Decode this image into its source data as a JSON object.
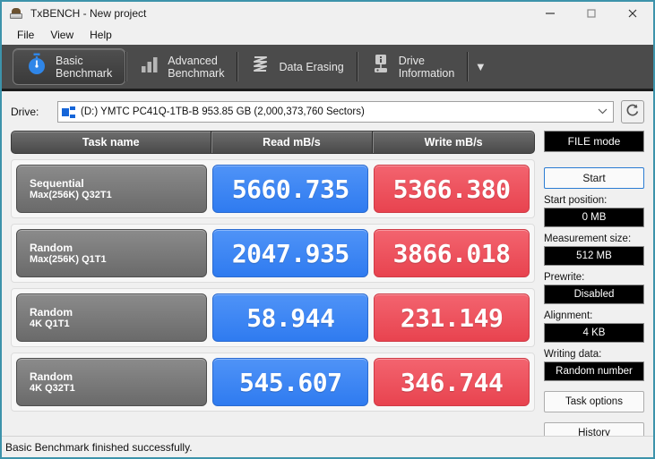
{
  "window": {
    "title": "TxBENCH - New project",
    "icon": "app-icon",
    "controls": {
      "minimize": "—",
      "maximize": "□",
      "close": "✕"
    }
  },
  "menubar": {
    "items": [
      {
        "label": "File"
      },
      {
        "label": "View"
      },
      {
        "label": "Help"
      }
    ]
  },
  "tabs": [
    {
      "label": "Basic\nBenchmark",
      "icon": "stopwatch-icon",
      "active": true
    },
    {
      "label": "Advanced\nBenchmark",
      "icon": "bar-chart-icon",
      "active": false
    },
    {
      "label": "Data Erasing",
      "icon": "shredder-icon",
      "active": false
    },
    {
      "label": "Drive\nInformation",
      "icon": "drive-info-icon",
      "active": false
    }
  ],
  "tab_overflow": {
    "icon": "chevron-down-icon",
    "label": "▼"
  },
  "drive": {
    "label": "Drive:",
    "selected": "(D:) YMTC PC41Q-1TB-B  953.85 GB (2,000,373,760 Sectors)",
    "dropdown_icon": "chevron-down-icon",
    "refresh_icon": "refresh-icon"
  },
  "table": {
    "headers": {
      "task": "Task name",
      "read": "Read mB/s",
      "write": "Write mB/s"
    },
    "rows": [
      {
        "name_line1": "Sequential",
        "name_line2": "Max(256K) Q32T1",
        "read": "5660.735",
        "write": "5366.380"
      },
      {
        "name_line1": "Random",
        "name_line2": "Max(256K) Q1T1",
        "read": "2047.935",
        "write": "3866.018"
      },
      {
        "name_line1": "Random",
        "name_line2": "4K Q1T1",
        "read": "58.944",
        "write": "231.149"
      },
      {
        "name_line1": "Random",
        "name_line2": "4K Q32T1",
        "read": "545.607",
        "write": "346.744"
      }
    ]
  },
  "sidebar": {
    "mode_button": "FILE mode",
    "start_button": "Start",
    "fields": [
      {
        "label": "Start position:",
        "value": "0 MB"
      },
      {
        "label": "Measurement size:",
        "value": "512 MB"
      },
      {
        "label": "Prewrite:",
        "value": "Disabled"
      },
      {
        "label": "Alignment:",
        "value": "4 KB"
      },
      {
        "label": "Writing data:",
        "value": "Random number"
      }
    ],
    "task_options_button": "Task options",
    "history_button": "History"
  },
  "statusbar": {
    "message": "Basic Benchmark finished successfully."
  },
  "colors": {
    "read_accent": "#3b82f6",
    "write_accent": "#ef4450",
    "window_border": "#3d93ab",
    "tabstrip_bg": "#4b4b4b",
    "panel_bg": "#f0f0f0"
  }
}
